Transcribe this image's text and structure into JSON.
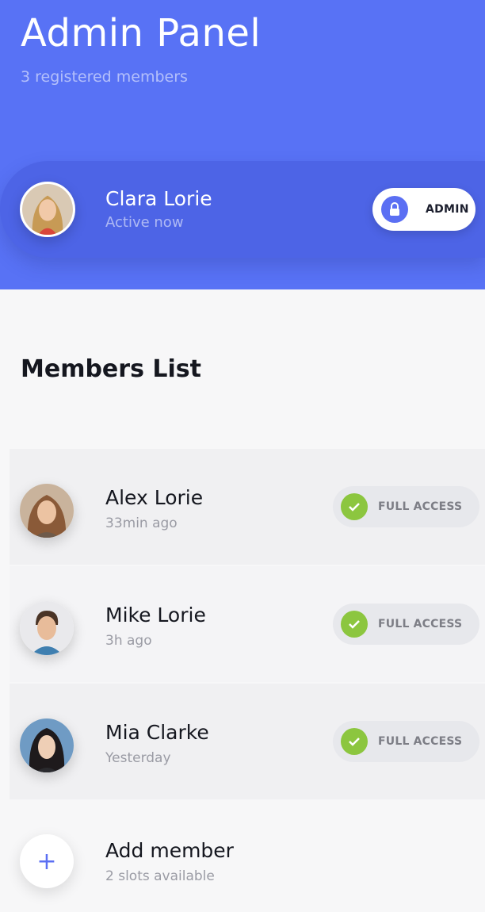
{
  "header": {
    "title": "Admin Panel",
    "subtitle": "3 registered members"
  },
  "admin": {
    "name": "Clara Lorie",
    "status": "Active now",
    "role_label": "ADMIN",
    "role_icon": "lock-icon"
  },
  "members_section": {
    "title": "Members List"
  },
  "members": [
    {
      "name": "Alex Lorie",
      "time": "33min ago",
      "access": "FULL ACCESS"
    },
    {
      "name": "Mike Lorie",
      "time": "3h ago",
      "access": "FULL ACCESS"
    },
    {
      "name": "Mia Clarke",
      "time": "Yesterday",
      "access": "FULL ACCESS"
    }
  ],
  "add_member": {
    "title": "Add member",
    "subtitle": "2 slots available",
    "icon": "plus-icon",
    "glyph": "+"
  },
  "colors": {
    "header_bg": "#5872f5",
    "admin_card_bg": "#4d64e6",
    "access_check": "#8cc63f",
    "accent": "#5b6ff3"
  }
}
